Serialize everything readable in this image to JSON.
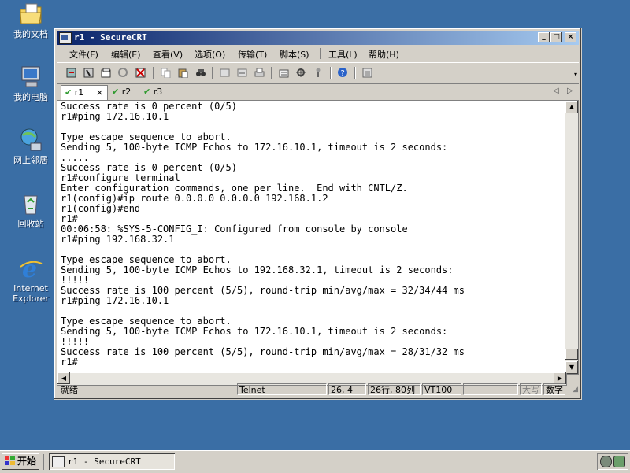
{
  "desktop": {
    "icons": [
      {
        "label": "我的文档",
        "icon": "folder-documents-icon"
      },
      {
        "label": "我的电脑",
        "icon": "computer-icon"
      },
      {
        "label": "网上邻居",
        "icon": "network-icon"
      },
      {
        "label": "回收站",
        "icon": "recycle-bin-icon"
      },
      {
        "label": "Internet Explorer",
        "icon": "ie-icon"
      }
    ]
  },
  "window": {
    "title": "r1 - SecureCRT",
    "controls": {
      "minimize": "_",
      "maximize": "□",
      "close": "×"
    }
  },
  "menu": {
    "items": [
      "文件(F)",
      "编辑(E)",
      "查看(V)",
      "选项(O)",
      "传输(T)",
      "脚本(S)",
      "工具(L)",
      "帮助(H)"
    ]
  },
  "tabs": [
    {
      "label": "r1",
      "close": "×",
      "active": true
    },
    {
      "label": "r2",
      "active": false
    },
    {
      "label": "r3",
      "active": false
    }
  ],
  "tab_nav": {
    "prev": "◁",
    "next": "▷"
  },
  "terminal": {
    "lines": [
      "Success rate is 0 percent (0/5)",
      "r1#ping 172.16.10.1",
      "",
      "Type escape sequence to abort.",
      "Sending 5, 100-byte ICMP Echos to 172.16.10.1, timeout is 2 seconds:",
      ".....",
      "Success rate is 0 percent (0/5)",
      "r1#configure terminal",
      "Enter configuration commands, one per line.  End with CNTL/Z.",
      "r1(config)#ip route 0.0.0.0 0.0.0.0 192.168.1.2",
      "r1(config)#end",
      "r1#",
      "00:06:58: %SYS-5-CONFIG_I: Configured from console by console",
      "r1#ping 192.168.32.1",
      "",
      "Type escape sequence to abort.",
      "Sending 5, 100-byte ICMP Echos to 192.168.32.1, timeout is 2 seconds:",
      "!!!!!",
      "Success rate is 100 percent (5/5), round-trip min/avg/max = 32/34/44 ms",
      "r1#ping 172.16.10.1",
      "",
      "Type escape sequence to abort.",
      "Sending 5, 100-byte ICMP Echos to 172.16.10.1, timeout is 2 seconds:",
      "!!!!!",
      "Success rate is 100 percent (5/5), round-trip min/avg/max = 28/31/32 ms",
      "r1#"
    ]
  },
  "status": {
    "ready": "就绪",
    "protocol": "Telnet",
    "cursor": "26,  4",
    "size": "26行, 80列",
    "emulation": "VT100",
    "caps": "大写",
    "num": "数字"
  },
  "taskbar": {
    "start_label": "开始",
    "task_label": "r1 - SecureCRT"
  }
}
